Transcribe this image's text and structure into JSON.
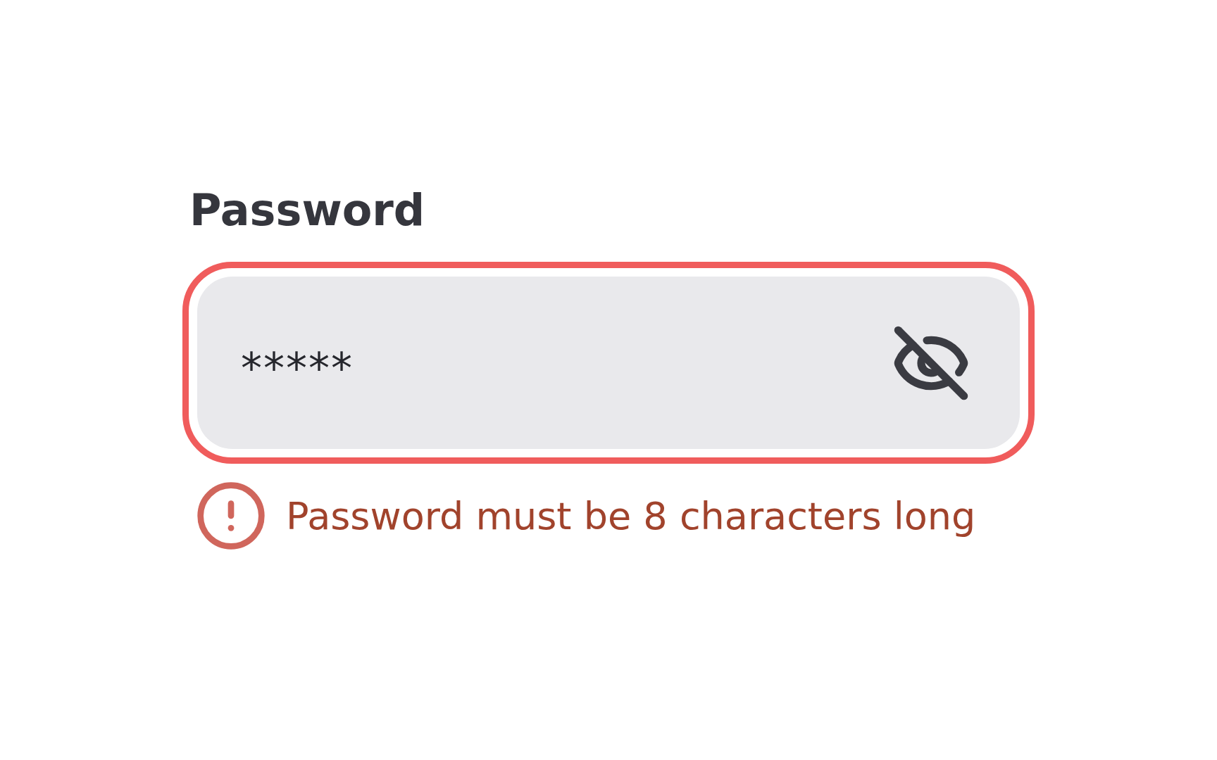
{
  "label": "Password",
  "field": {
    "value": "*****",
    "invalid": true,
    "revealed": false
  },
  "error_message": "Password must be 8 characters long"
}
